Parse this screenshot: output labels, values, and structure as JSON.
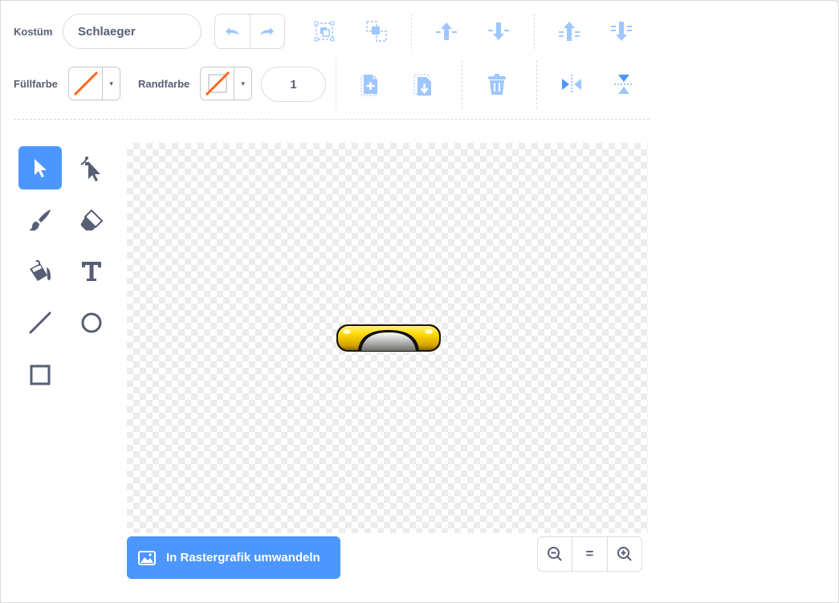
{
  "costume": {
    "label": "Kostüm",
    "name": "Schlaeger"
  },
  "fill": {
    "label": "Füllfarbe",
    "dropdown": "▾"
  },
  "outline": {
    "label": "Randfarbe",
    "dropdown": "▾",
    "width": "1"
  },
  "convert_button": {
    "label": "In Rastergrafik umwandeln"
  },
  "zoom": {
    "reset_label": "="
  },
  "icons": {
    "undo": "undo-icon",
    "redo": "redo-icon",
    "group": "group-icon",
    "ungroup": "ungroup-icon",
    "forward": "forward-icon",
    "backward": "backward-icon",
    "front": "front-icon",
    "back": "back-icon",
    "copy": "copy-icon",
    "paste": "paste-icon",
    "delete": "delete-icon",
    "flip_h": "flip-horizontal-icon",
    "flip_v": "flip-vertical-icon"
  },
  "tools": [
    "select",
    "reshape",
    "brush",
    "eraser",
    "fill",
    "text",
    "line",
    "circle",
    "rectangle"
  ],
  "active_tool": "select",
  "colors": {
    "accent": "#4c97ff",
    "icon_faded": "#9ec6ff",
    "text": "#575e75",
    "no_color": "#ff661a"
  }
}
